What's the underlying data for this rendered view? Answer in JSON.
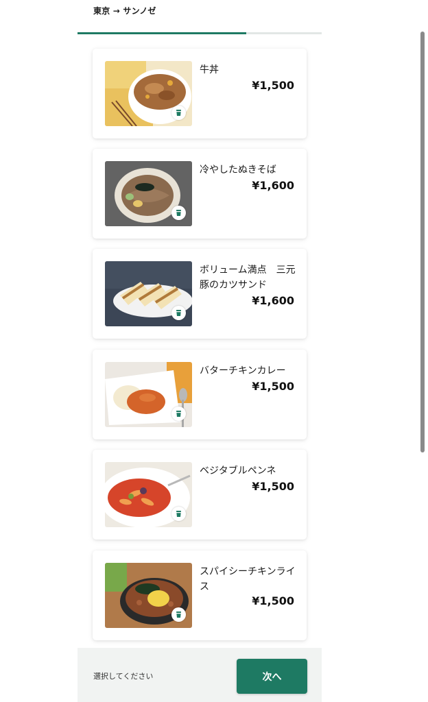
{
  "header": {
    "route": "東京 → サンノゼ",
    "progress": 0.69
  },
  "menu": {
    "items": [
      {
        "name": "牛丼",
        "price": "¥1,500"
      },
      {
        "name": "冷やしたぬきそば",
        "price": "¥1,600"
      },
      {
        "name": "ボリューム満点　三元豚のカツサンド",
        "price": "¥1,600"
      },
      {
        "name": "バターチキンカレー",
        "price": "¥1,500"
      },
      {
        "name": "ベジタブルペンネ",
        "price": "¥1,500"
      },
      {
        "name": "スパイシーチキンライス",
        "price": "¥1,500"
      }
    ]
  },
  "footer": {
    "prompt": "選択してください",
    "next_label": "次へ"
  },
  "colors": {
    "accent": "#1e7a63"
  }
}
